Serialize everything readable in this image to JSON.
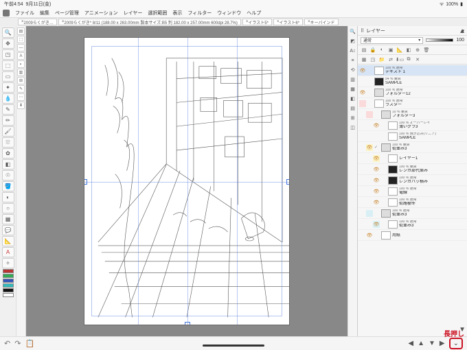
{
  "status": {
    "time": "午前4:54",
    "date": "9月11日(金)",
    "battery": "100%"
  },
  "menu": [
    "ファイル",
    "編集",
    "ページ管理",
    "アニメーション",
    "レイヤー",
    "選択範囲",
    "表示",
    "フィルター",
    "ウィンドウ",
    "ヘルプ"
  ],
  "tabs": {
    "t1": "2009らくがき…",
    "t2": "2009らくがき* 8/11 (188.00 x 263.00mm 製本サイズ:B5 判 182.00 x 257.00mm 600dpi 28.7%)",
    "t3": "イラスト5*",
    "t4": "イラスト6*",
    "t5": "キーバインド"
  },
  "panel": {
    "title": "レイヤー",
    "mode": "通常",
    "opacity": "100"
  },
  "layers": [
    {
      "vis": "👁",
      "mode": "100 % 通常",
      "name": "テキスト 1",
      "sel": true
    },
    {
      "vis": "",
      "mode": "54 % 乗算",
      "name": "SAMPLE",
      "thumb": "dark"
    },
    {
      "vis": "👁",
      "mode": "100 % 通常",
      "name": "フォルダー12",
      "thumb": "folder"
    },
    {
      "vis": "",
      "mode": "100 % 通常",
      "name": "ラスター",
      "notch": "pink"
    },
    {
      "vis": "",
      "mode": "10 % 乗算",
      "name": "フォルダー3",
      "thumb": "folder",
      "notch": "pink",
      "indent": 1
    },
    {
      "vis": "👁",
      "mode": "100 % オーバーレイ",
      "name": "薄いグラ3",
      "indent": 2
    },
    {
      "vis": "",
      "mode": "100 % 焼き込み(リニア)",
      "name": "SAMPLE",
      "indent": 2
    },
    {
      "vis": "👁",
      "mode": "100 % 乗算",
      "name": "街並み3",
      "thumb": "folder",
      "notch": "yellow",
      "indent": 1,
      "check": true
    },
    {
      "vis": "👁",
      "mode": "",
      "name": "レイヤー1",
      "notch": "yellow",
      "indent": 2
    },
    {
      "vis": "👁",
      "mode": "100 % 乗算",
      "name": "レンガ部代案み",
      "thumb": "dark",
      "indent": 2
    },
    {
      "vis": "👁",
      "mode": "100 % 通常",
      "name": "レンガパッ積み",
      "thumb": "dark",
      "indent": 2
    },
    {
      "vis": "👁",
      "mode": "100 % 通常",
      "name": "電線",
      "indent": 2
    },
    {
      "vis": "👁",
      "mode": "100 % 通常",
      "name": "街路樹冬",
      "indent": 2
    },
    {
      "vis": "",
      "mode": "100 % 通常",
      "name": "街並み3",
      "thumb": "folder",
      "notch": "blue",
      "indent": 1
    },
    {
      "vis": "👁",
      "mode": "100 % 通常",
      "name": "街並み3",
      "notch": "blue",
      "indent": 2
    },
    {
      "vis": "👁",
      "mode": "",
      "name": "用紙",
      "indent": 1
    }
  ],
  "annotation": "長押し"
}
